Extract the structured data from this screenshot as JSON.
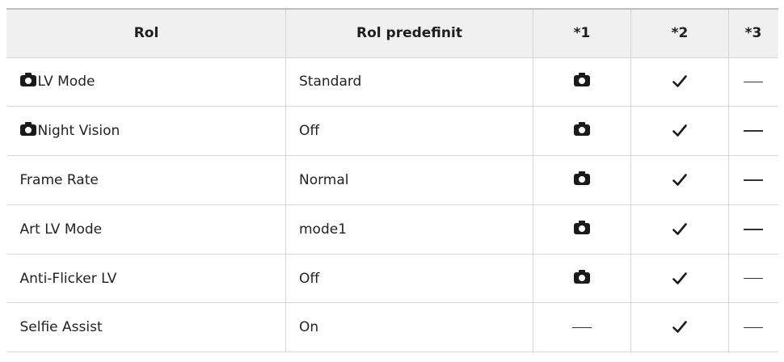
{
  "table": {
    "headers": {
      "role": "Rol",
      "default": "Rol predefinit",
      "col1": "*1",
      "col2": "*2",
      "col3": "*3"
    },
    "rows": [
      {
        "role": "LV Mode",
        "role_prefix_icon": "camera-icon",
        "default": "Standard",
        "c1": "camera-icon",
        "c2": "check-icon",
        "c3": "dash-icon"
      },
      {
        "role": "Night Vision",
        "role_prefix_icon": "camera-icon",
        "default": "Off",
        "c1": "camera-icon",
        "c2": "check-icon",
        "c3": "dash-icon"
      },
      {
        "role": "Frame Rate",
        "default": "Normal",
        "c1": "camera-icon",
        "c2": "check-icon",
        "c3": "dash-icon"
      },
      {
        "role": "Art LV Mode",
        "default": "mode1",
        "c1": "camera-icon",
        "c2": "check-icon",
        "c3": "dash-icon"
      },
      {
        "role": "Anti-Flicker LV",
        "default": "Off",
        "c1": "camera-icon",
        "c2": "check-icon",
        "c3": "dash-icon"
      },
      {
        "role": "Selfie Assist",
        "default": "On",
        "c1": "dash-icon",
        "c2": "check-icon",
        "c3": "dash-icon"
      }
    ]
  }
}
